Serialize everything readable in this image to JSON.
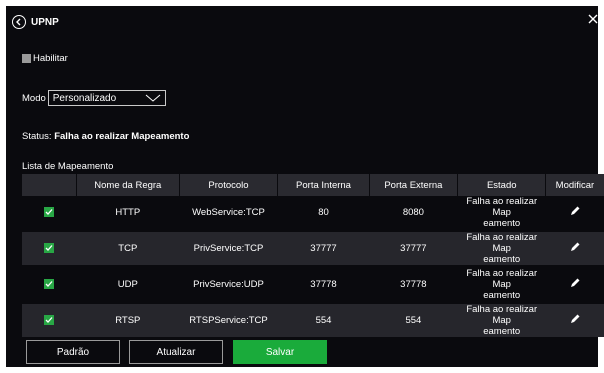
{
  "header": {
    "title": "UPNP"
  },
  "enable": {
    "label": "Habilitar",
    "checked": false
  },
  "mode": {
    "label": "Modo",
    "value": "Personalizado"
  },
  "status": {
    "label": "Status:",
    "value": "Falha ao realizar Mapeamento"
  },
  "mapping": {
    "title": "Lista de Mapeamento",
    "columns": [
      "",
      "Nome da Regra",
      "Protocolo",
      "Porta Interna",
      "Porta Externa",
      "Estado",
      "Modificar"
    ],
    "rows": [
      {
        "enabled": true,
        "name": "HTTP",
        "protocol": "WebService:TCP",
        "internal": "80",
        "external": "8080",
        "state_line1": "Falha ao realizar Map",
        "state_line2": "eamento"
      },
      {
        "enabled": true,
        "name": "TCP",
        "protocol": "PrivService:TCP",
        "internal": "37777",
        "external": "37777",
        "state_line1": "Falha ao realizar Map",
        "state_line2": "eamento"
      },
      {
        "enabled": true,
        "name": "UDP",
        "protocol": "PrivService:UDP",
        "internal": "37778",
        "external": "37778",
        "state_line1": "Falha ao realizar Map",
        "state_line2": "eamento"
      },
      {
        "enabled": true,
        "name": "RTSP",
        "protocol": "RTSPService:TCP",
        "internal": "554",
        "external": "554",
        "state_line1": "Falha ao realizar Map",
        "state_line2": "eamento"
      }
    ]
  },
  "buttons": {
    "default": "Padrão",
    "refresh": "Atualizar",
    "save": "Salvar"
  },
  "colors": {
    "background": "#0a0a0e",
    "accent": "#1aab3b",
    "checkbox_on": "#28a745",
    "row_alt": "#26262c"
  },
  "icons": {
    "back": "back-circle-icon",
    "close": "close-icon",
    "dropdown": "chevron-down-icon",
    "check": "check-icon",
    "edit": "pencil-icon"
  }
}
